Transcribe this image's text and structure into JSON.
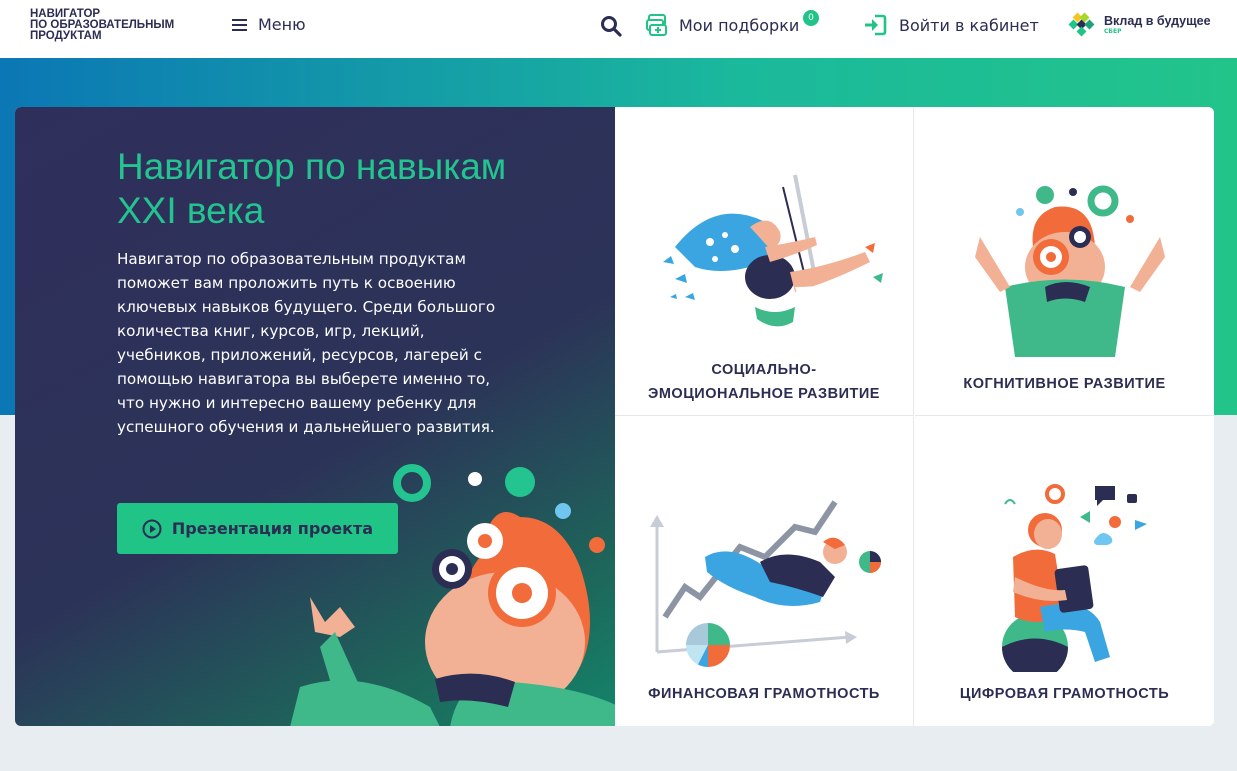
{
  "header": {
    "logo_line1": "НАВИГАТОР",
    "logo_line2": "ПО ОБРАЗОВАТЕЛЬНЫМ",
    "logo_line3": "ПРОДУКТАМ",
    "menu_label": "Меню",
    "collections_label": "Мои подборки",
    "collections_count": "0",
    "login_label": "Войти в кабинет",
    "partner_label": "Вклад в будущее",
    "partner_sub": "СБЕР"
  },
  "hero": {
    "title": "Навигатор по навыкам XXI века",
    "description": "Навигатор по образовательным продуктам поможет вам проложить путь к освоению ключевых навыков будущего. Среди большого количества книг, курсов, игр, лекций, учебников, приложений, ресурсов, лагерей с помощью навигатора вы выберете именно то, что нужно и интересно вашему ребенку для успешного обучения и дальнейшего развития.",
    "button_label": "Презентация проекта"
  },
  "skills": [
    {
      "label": "СОЦИАЛЬНО-ЭМОЦИОНАЛЬНОЕ РАЗВИТИЕ",
      "icon": "swing-girl-illustration"
    },
    {
      "label": "КОГНИТИВНОЕ РАЗВИТИЕ",
      "icon": "gears-head-illustration"
    },
    {
      "label": "ФИНАНСОВАЯ ГРАМОТНОСТЬ",
      "icon": "growth-chart-illustration"
    },
    {
      "label": "ЦИФРОВАЯ ГРАМОТНОСТЬ",
      "icon": "tablet-boy-illustration"
    }
  ],
  "colors": {
    "accent": "#1fc486",
    "dark": "#2b2d52",
    "orange": "#f26b3a"
  }
}
